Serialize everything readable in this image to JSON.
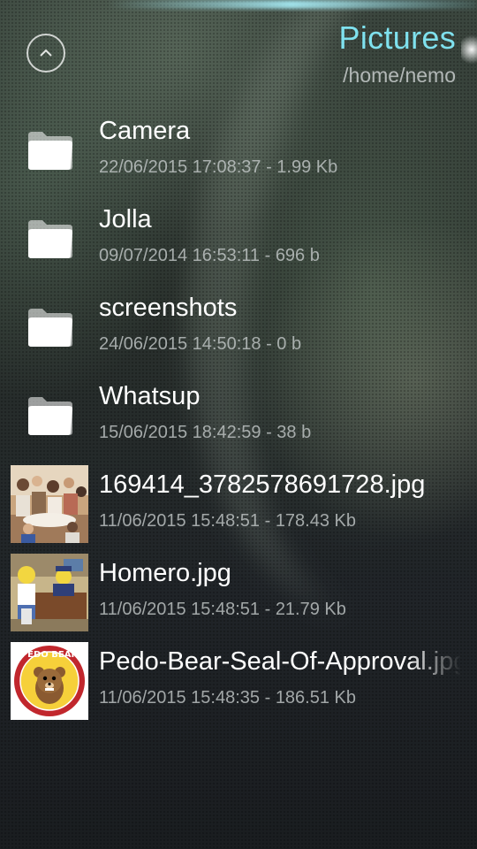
{
  "header": {
    "title": "Pictures",
    "path": "/home/nemo",
    "up_icon": "chevron-up-icon",
    "accent_color": "#7fe1ee"
  },
  "files": [
    {
      "name": "Camera",
      "date": "22/06/2015 17:08:37",
      "size": "1.99 Kb",
      "type": "folder",
      "icon": "folder-icon"
    },
    {
      "name": "Jolla",
      "date": "09/07/2014 16:53:11",
      "size": "696 b",
      "type": "folder",
      "icon": "folder-icon"
    },
    {
      "name": "screenshots",
      "date": "24/06/2015 14:50:18",
      "size": "0 b",
      "type": "folder",
      "icon": "folder-icon"
    },
    {
      "name": "Whatsup",
      "date": "15/06/2015 18:42:59",
      "size": "38 b",
      "type": "folder",
      "icon": "folder-icon"
    },
    {
      "name": "169414_3782578691728.jpg",
      "date": "11/06/2015 15:48:51",
      "size": "178.43 Kb",
      "type": "image",
      "icon": "photo-thumbnail"
    },
    {
      "name": "Homero.jpg",
      "date": "11/06/2015 15:48:51",
      "size": "21.79 Kb",
      "type": "image",
      "icon": "photo-thumbnail"
    },
    {
      "name": "Pedo-Bear-Seal-Of-Approval.jpg",
      "date": "11/06/2015 15:48:35",
      "size": "186.51 Kb",
      "type": "image",
      "icon": "photo-thumbnail"
    }
  ],
  "meta_separator": " - ",
  "thumbnail_seal_text": "PEDO BEAR"
}
